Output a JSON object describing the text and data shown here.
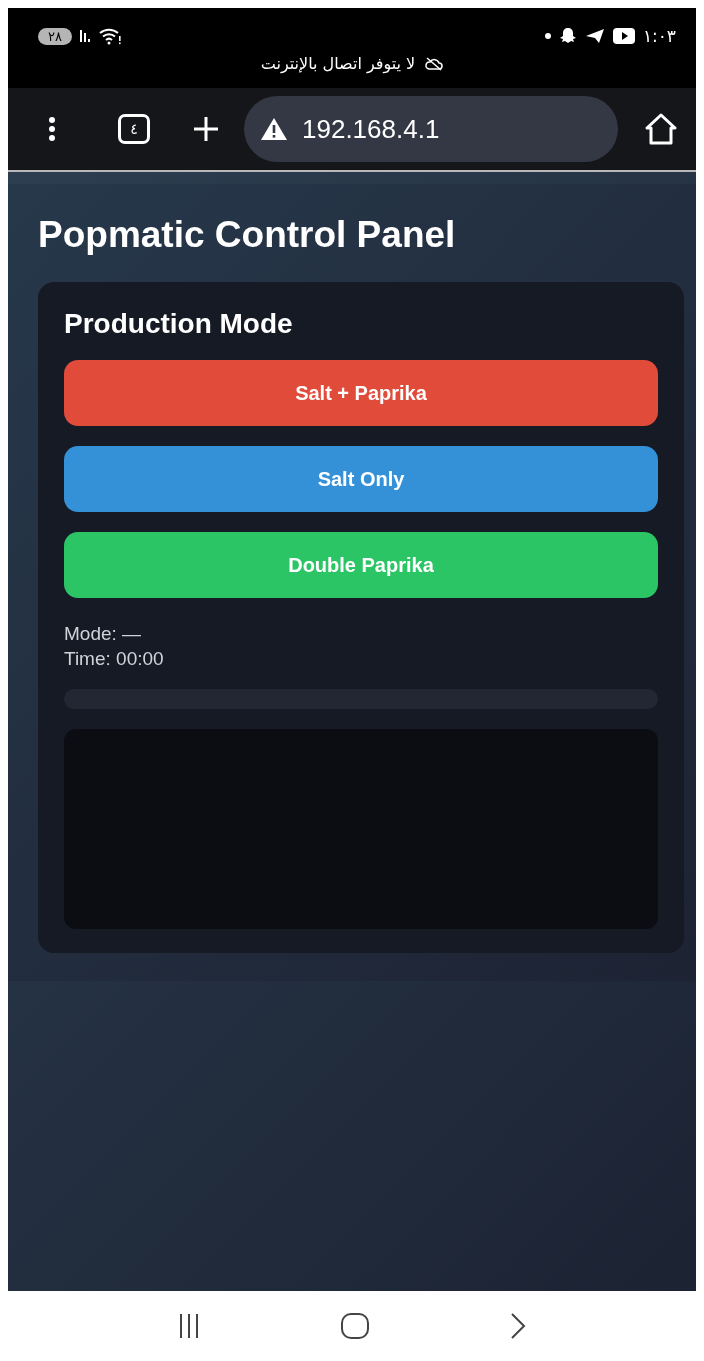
{
  "status_bar": {
    "battery": "٢٨",
    "time": "١:٠٣",
    "notice": "لا يتوفر اتصال بالإنترنت"
  },
  "browser": {
    "tab_count": "٤",
    "url": "192.168.4.1"
  },
  "page": {
    "title": "Popmatic Control Panel",
    "card": {
      "heading": "Production Mode",
      "buttons": [
        {
          "label": "Salt + Paprika",
          "color": "#e04b3a"
        },
        {
          "label": "Salt Only",
          "color": "#3491d8"
        },
        {
          "label": "Double Paprika",
          "color": "#2cc565"
        }
      ],
      "mode": "Mode: —",
      "time": "Time: 00:00",
      "progress": {
        "level": 0
      }
    }
  }
}
